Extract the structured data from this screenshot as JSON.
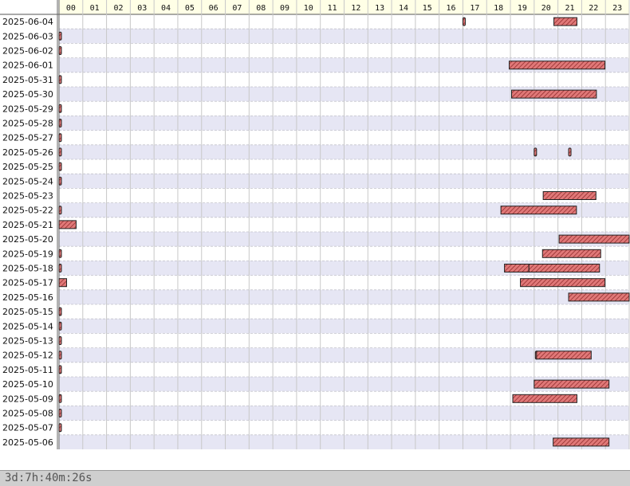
{
  "chart_data": {
    "type": "gantt",
    "x_unit": "hour of day",
    "xlim": [
      0,
      24
    ],
    "hours": [
      "00",
      "01",
      "02",
      "03",
      "04",
      "05",
      "06",
      "07",
      "08",
      "09",
      "10",
      "11",
      "12",
      "13",
      "14",
      "15",
      "16",
      "17",
      "18",
      "19",
      "20",
      "21",
      "22",
      "23"
    ],
    "days": [
      {
        "date": "2025-06-04",
        "intervals": [
          [
            17.0,
            17.06
          ],
          [
            20.83,
            21.8
          ]
        ]
      },
      {
        "date": "2025-06-03",
        "intervals": [
          [
            0.0,
            0.02
          ]
        ]
      },
      {
        "date": "2025-06-02",
        "intervals": [
          [
            0.0,
            0.02
          ]
        ]
      },
      {
        "date": "2025-06-01",
        "intervals": [
          [
            18.95,
            22.98
          ]
        ]
      },
      {
        "date": "2025-05-31",
        "intervals": [
          [
            0.0,
            0.02
          ]
        ]
      },
      {
        "date": "2025-05-30",
        "intervals": [
          [
            19.05,
            22.62
          ]
        ]
      },
      {
        "date": "2025-05-29",
        "intervals": [
          [
            0.0,
            0.02
          ]
        ]
      },
      {
        "date": "2025-05-28",
        "intervals": [
          [
            0.0,
            0.02
          ]
        ]
      },
      {
        "date": "2025-05-27",
        "intervals": [
          [
            0.0,
            0.02
          ]
        ]
      },
      {
        "date": "2025-05-26",
        "intervals": [
          [
            0.0,
            0.02
          ],
          [
            20.0,
            20.05
          ],
          [
            21.45,
            21.5
          ]
        ]
      },
      {
        "date": "2025-05-25",
        "intervals": [
          [
            0.0,
            0.02
          ]
        ]
      },
      {
        "date": "2025-05-24",
        "intervals": [
          [
            0.0,
            0.02
          ]
        ]
      },
      {
        "date": "2025-05-23",
        "intervals": [
          [
            20.38,
            22.6
          ]
        ]
      },
      {
        "date": "2025-05-22",
        "intervals": [
          [
            0.0,
            0.02
          ],
          [
            18.6,
            21.78
          ]
        ]
      },
      {
        "date": "2025-05-21",
        "intervals": [
          [
            0.0,
            0.72
          ]
        ]
      },
      {
        "date": "2025-05-20",
        "intervals": [
          [
            21.05,
            24.0
          ]
        ]
      },
      {
        "date": "2025-05-19",
        "intervals": [
          [
            0.0,
            0.02
          ],
          [
            20.35,
            22.8
          ]
        ]
      },
      {
        "date": "2025-05-18",
        "intervals": [
          [
            0.0,
            0.02
          ],
          [
            18.75,
            19.78
          ],
          [
            19.78,
            22.75
          ]
        ]
      },
      {
        "date": "2025-05-17",
        "intervals": [
          [
            0.0,
            0.32
          ],
          [
            19.42,
            22.98
          ]
        ]
      },
      {
        "date": "2025-05-16",
        "intervals": [
          [
            21.45,
            24.0
          ]
        ]
      },
      {
        "date": "2025-05-15",
        "intervals": [
          [
            0.0,
            0.02
          ]
        ]
      },
      {
        "date": "2025-05-14",
        "intervals": [
          [
            0.0,
            0.02
          ]
        ]
      },
      {
        "date": "2025-05-13",
        "intervals": [
          [
            0.0,
            0.02
          ]
        ]
      },
      {
        "date": "2025-05-12",
        "intervals": [
          [
            0.0,
            0.02
          ],
          [
            20.05,
            20.15
          ],
          [
            20.1,
            22.4
          ]
        ]
      },
      {
        "date": "2025-05-11",
        "intervals": [
          [
            0.0,
            0.02
          ]
        ]
      },
      {
        "date": "2025-05-10",
        "intervals": [
          [
            20.0,
            23.15
          ]
        ]
      },
      {
        "date": "2025-05-09",
        "intervals": [
          [
            0.0,
            0.02
          ],
          [
            19.1,
            21.8
          ]
        ]
      },
      {
        "date": "2025-05-08",
        "intervals": [
          [
            0.0,
            0.02
          ]
        ]
      },
      {
        "date": "2025-05-07",
        "intervals": [
          [
            0.0,
            0.02
          ]
        ]
      },
      {
        "date": "2025-05-06",
        "intervals": [
          [
            20.8,
            23.15
          ]
        ]
      }
    ],
    "colors": {
      "bar_fill": "#e07878",
      "bar_hatch": "#8a2424",
      "bar_border": "#222222",
      "row_alt": "#e6e6f4",
      "row_base": "#ffffff",
      "header_bg": "#ffffe6"
    },
    "grid": true,
    "legend": "none"
  },
  "footer": {
    "total": "3d:7h:40m:26s"
  }
}
